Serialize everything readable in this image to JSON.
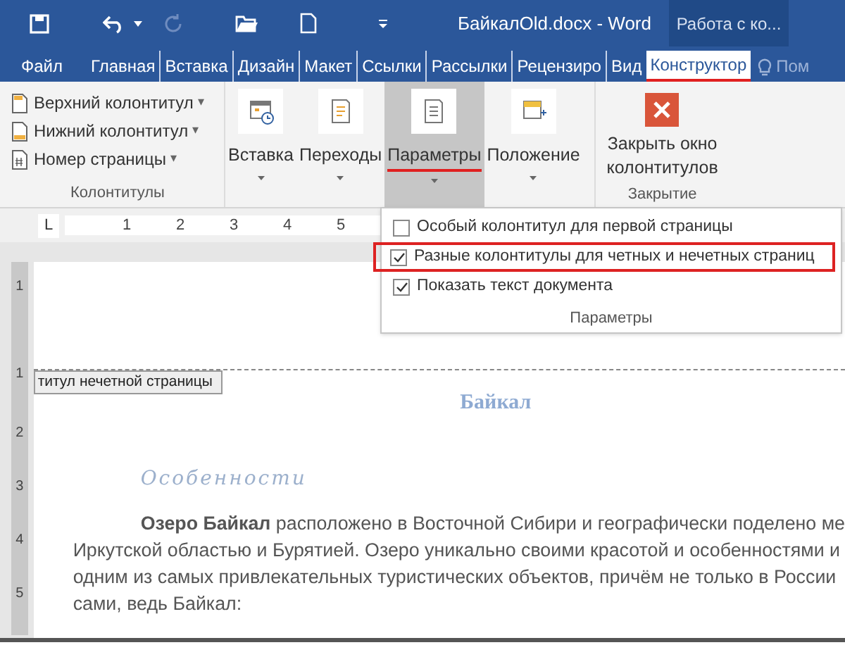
{
  "title_bar": {
    "title": "БайкалOld.docx - Word",
    "context_label": "Работа с ко..."
  },
  "tabs": [
    {
      "label": "Файл",
      "selected": false
    },
    {
      "label": "Главная",
      "selected": false
    },
    {
      "label": "Вставка",
      "selected": false
    },
    {
      "label": "Дизайн",
      "selected": false
    },
    {
      "label": "Макет",
      "selected": false
    },
    {
      "label": "Ссылки",
      "selected": false
    },
    {
      "label": "Рассылки",
      "selected": false
    },
    {
      "label": "Рецензиро",
      "selected": false
    },
    {
      "label": "Вид",
      "selected": false
    },
    {
      "label": "Конструктор",
      "selected": true
    }
  ],
  "help_label": "Пом",
  "ribbon": {
    "header_footer_group": {
      "label": "Колонтитулы",
      "items": [
        {
          "label": "Верхний колонтитул",
          "caret": "▾"
        },
        {
          "label": "Нижний колонтитул",
          "caret": "▾"
        },
        {
          "label": "Номер страницы",
          "caret": "▾"
        }
      ]
    },
    "big_buttons": [
      {
        "kind": "datetime",
        "label": "Вставка",
        "selected": false
      },
      {
        "kind": "navigation",
        "label": "Переходы",
        "selected": false
      },
      {
        "kind": "options",
        "label": "Параметры",
        "selected": true
      },
      {
        "kind": "position",
        "label": "Положение",
        "selected": false
      }
    ],
    "close_group": {
      "label": "Закрытие",
      "button": "Закрыть окно колонтитулов"
    }
  },
  "options_menu": {
    "items": [
      {
        "label": "Особый колонтитул для первой страницы",
        "checked": false,
        "highlighted": false
      },
      {
        "label": "Разные колонтитулы для четных и нечетных страниц",
        "checked": true,
        "highlighted": true
      },
      {
        "label": "Показать текст документа",
        "checked": true,
        "highlighted": false
      }
    ],
    "group_label": "Параметры"
  },
  "ruler": {
    "tab_selector": "L",
    "marks": [
      "1",
      "2",
      "3",
      "4",
      "5"
    ]
  },
  "vertical_ruler": {
    "marks": [
      "1",
      "1",
      "2",
      "3",
      "4",
      "5"
    ]
  },
  "document": {
    "header_tag": "титул нечетной страницы",
    "heading": "Байкал",
    "subheading": "Особенности",
    "paragraph_lines": [
      "**Озеро Байкал** расположено в Восточной Сибири и географически поделено ме",
      "Иркутской областью и Бурятией. Озеро уникально своими красотой и особенностями и",
      "одним из самых привлекательных туристических объектов, причём не только в России",
      "сами, ведь Байкал:"
    ]
  }
}
